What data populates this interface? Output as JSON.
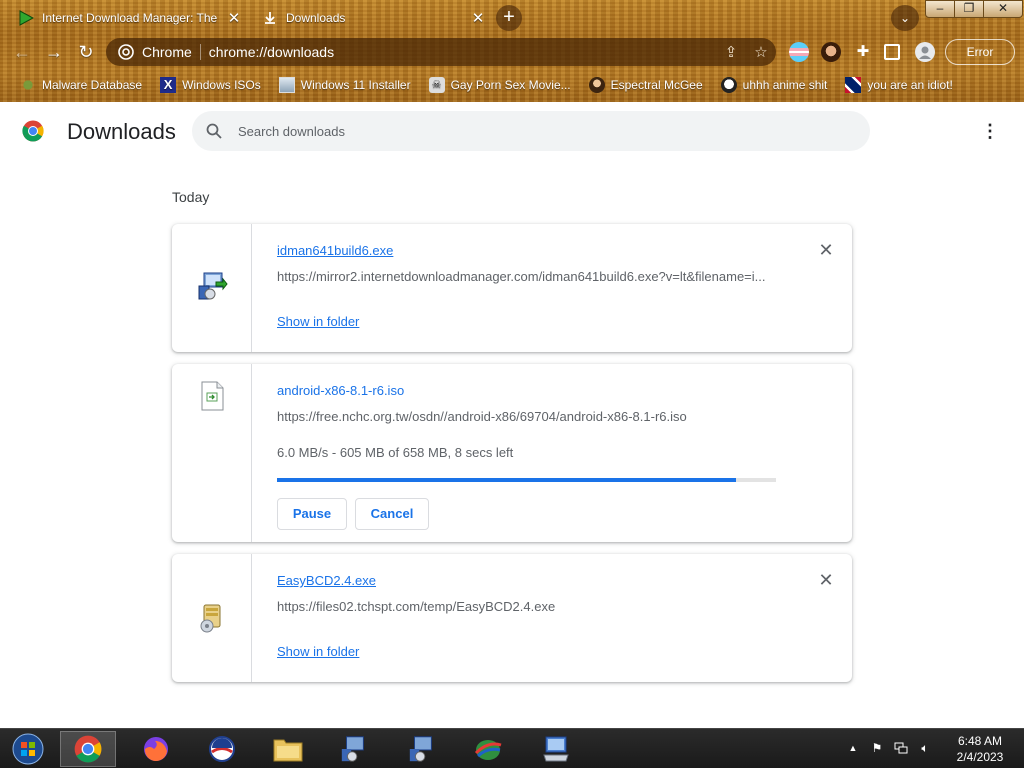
{
  "tabs": [
    {
      "title": "Internet Download Manager: The",
      "icon": "idm-play-icon",
      "active": false
    },
    {
      "title": "Downloads",
      "icon": "download-icon",
      "active": true
    }
  ],
  "toolbar": {
    "omnibox_label": "Chrome",
    "url": "chrome://downloads",
    "profile_button": "Error"
  },
  "bookmarks": [
    {
      "label": "Malware Database",
      "icon": "leaf-icon"
    },
    {
      "label": "Windows ISOs",
      "icon": "x-icon"
    },
    {
      "label": "Windows 11 Installer",
      "icon": "image-icon"
    },
    {
      "label": "Gay Porn Sex Movie...",
      "icon": "skull-icon"
    },
    {
      "label": "Espectral McGee",
      "icon": "character-icon"
    },
    {
      "label": "uhhh anime shit",
      "icon": "anime-icon"
    },
    {
      "label": "you are an idiot!",
      "icon": "flag-icon"
    }
  ],
  "page": {
    "title": "Downloads",
    "search_placeholder": "Search downloads",
    "day_label": "Today"
  },
  "downloads": [
    {
      "filename": "idman641build6.exe",
      "url": "https://mirror2.internetdownloadmanager.com/idman641build6.exe?v=lt&filename=i...",
      "action": "Show in folder",
      "state": "complete"
    },
    {
      "filename": "android-x86-8.1-r6.iso",
      "url": "https://free.nchc.org.tw/osdn//android-x86/69704/android-x86-8.1-r6.iso",
      "status": "6.0 MB/s - 605 MB of 658 MB, 8 secs left",
      "progress": 0.92,
      "pause_label": "Pause",
      "cancel_label": "Cancel",
      "state": "in-progress"
    },
    {
      "filename": "EasyBCD2.4.exe",
      "url": "https://files02.tchspt.com/temp/EasyBCD2.4.exe",
      "action": "Show in folder",
      "state": "complete"
    }
  ],
  "taskbar": {
    "time": "6:48 AM",
    "date": "2/4/2023"
  },
  "colors": {
    "accent": "#1a73e8",
    "theme_wood": "#b57a24"
  }
}
